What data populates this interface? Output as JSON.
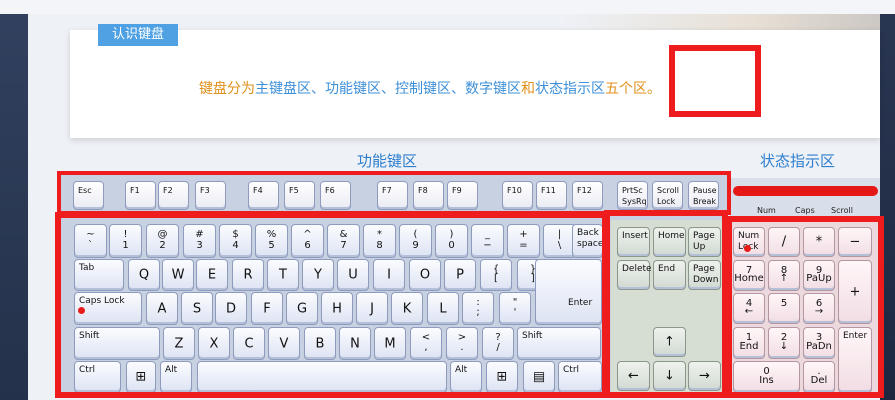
{
  "page": {
    "tag": "认识键盘",
    "description": {
      "p1": "键盘分为",
      "p2": "主键盘区、功能键区、控制键区、数字键区",
      "p3": "和",
      "p4": "状态指示区",
      "p5": "五个区。"
    },
    "label_func": "功能键区",
    "label_status": "状态指示区"
  },
  "indicators": [
    "Num",
    "Caps",
    "Scroll"
  ],
  "function_row": [
    {
      "label": "Esc"
    },
    {
      "label": "F1"
    },
    {
      "label": "F2"
    },
    {
      "label": "F3"
    },
    {
      "label": "F4"
    },
    {
      "label": "F5"
    },
    {
      "label": "F6"
    },
    {
      "label": "F7"
    },
    {
      "label": "F8"
    },
    {
      "label": "F9"
    },
    {
      "label": "F10"
    },
    {
      "label": "F11"
    },
    {
      "label": "F12"
    },
    {
      "label": "PrtSc\nSysRq"
    },
    {
      "label": "Scroll\nLock"
    },
    {
      "label": "Pause\nBreak"
    }
  ],
  "main_keys": {
    "row1": [
      {
        "t": "~",
        "b": "`"
      },
      {
        "t": "!",
        "b": "1"
      },
      {
        "t": "@",
        "b": "2"
      },
      {
        "t": "#",
        "b": "3"
      },
      {
        "t": "$",
        "b": "4"
      },
      {
        "t": "%",
        "b": "5"
      },
      {
        "t": "^",
        "b": "6"
      },
      {
        "t": "&",
        "b": "7"
      },
      {
        "t": "*",
        "b": "8"
      },
      {
        "t": "(",
        "b": "9"
      },
      {
        "t": ")",
        "b": "0"
      },
      {
        "t": "_",
        "b": "−"
      },
      {
        "t": "+",
        "b": "="
      },
      {
        "t": "|",
        "b": "\\"
      },
      {
        "l": "Back\nspace"
      }
    ],
    "row2": [
      {
        "l": "Tab"
      },
      {
        "c": "Q"
      },
      {
        "c": "W"
      },
      {
        "c": "E"
      },
      {
        "c": "R"
      },
      {
        "c": "T"
      },
      {
        "c": "Y"
      },
      {
        "c": "U"
      },
      {
        "c": "I"
      },
      {
        "c": "O"
      },
      {
        "c": "P"
      },
      {
        "t": "{",
        "b": "["
      },
      {
        "t": "}",
        "b": "]"
      }
    ],
    "row3": [
      {
        "l": "Caps Lock"
      },
      {
        "c": "A"
      },
      {
        "c": "S"
      },
      {
        "c": "D"
      },
      {
        "c": "F"
      },
      {
        "c": "G"
      },
      {
        "c": "H"
      },
      {
        "c": "J"
      },
      {
        "c": "K"
      },
      {
        "c": "L"
      },
      {
        "t": ":",
        "b": ";"
      },
      {
        "t": "\"",
        "b": "'"
      }
    ],
    "row4": [
      {
        "l": "Shift"
      },
      {
        "c": "Z"
      },
      {
        "c": "X"
      },
      {
        "c": "C"
      },
      {
        "c": "V"
      },
      {
        "c": "B"
      },
      {
        "c": "N"
      },
      {
        "c": "M"
      },
      {
        "t": "<",
        "b": ","
      },
      {
        "t": ">",
        "b": "."
      },
      {
        "t": "?",
        "b": "/"
      },
      {
        "l": "Shift"
      }
    ],
    "enter": "Enter",
    "row5": [
      {
        "l": "Ctrl"
      },
      {
        "c": "⊞"
      },
      {
        "l": "Alt"
      },
      {
        "c": ""
      },
      {
        "l": "Alt"
      },
      {
        "c": "⊞"
      },
      {
        "c": "▤"
      },
      {
        "l": "Ctrl"
      }
    ]
  },
  "control_keys": [
    {
      "l": "Insert"
    },
    {
      "l": "Home"
    },
    {
      "l": "Page\nUp"
    },
    {
      "l": "Delete"
    },
    {
      "l": "End"
    },
    {
      "l": "Page\nDown"
    },
    {
      "c": "↑"
    },
    {
      "c": "←"
    },
    {
      "c": "↓"
    },
    {
      "c": "→"
    }
  ],
  "numpad_keys": [
    {
      "l": "Num\nLock"
    },
    {
      "c": "/"
    },
    {
      "c": "*"
    },
    {
      "c": "−"
    },
    {
      "t": "7",
      "b": "Home"
    },
    {
      "t": "8",
      "b": "↑"
    },
    {
      "t": "9",
      "b": "PaUp"
    },
    {
      "c": "+"
    },
    {
      "t": "4",
      "b": "←"
    },
    {
      "t": "5",
      "b": ""
    },
    {
      "t": "6",
      "b": "→"
    },
    {
      "t": "1",
      "b": "End"
    },
    {
      "t": "2",
      "b": "↓"
    },
    {
      "t": "3",
      "b": "PaDn"
    },
    {
      "l": "Enter"
    },
    {
      "t": "0",
      "b": "Ins"
    },
    {
      "t": ".",
      "b": "Del"
    }
  ]
}
